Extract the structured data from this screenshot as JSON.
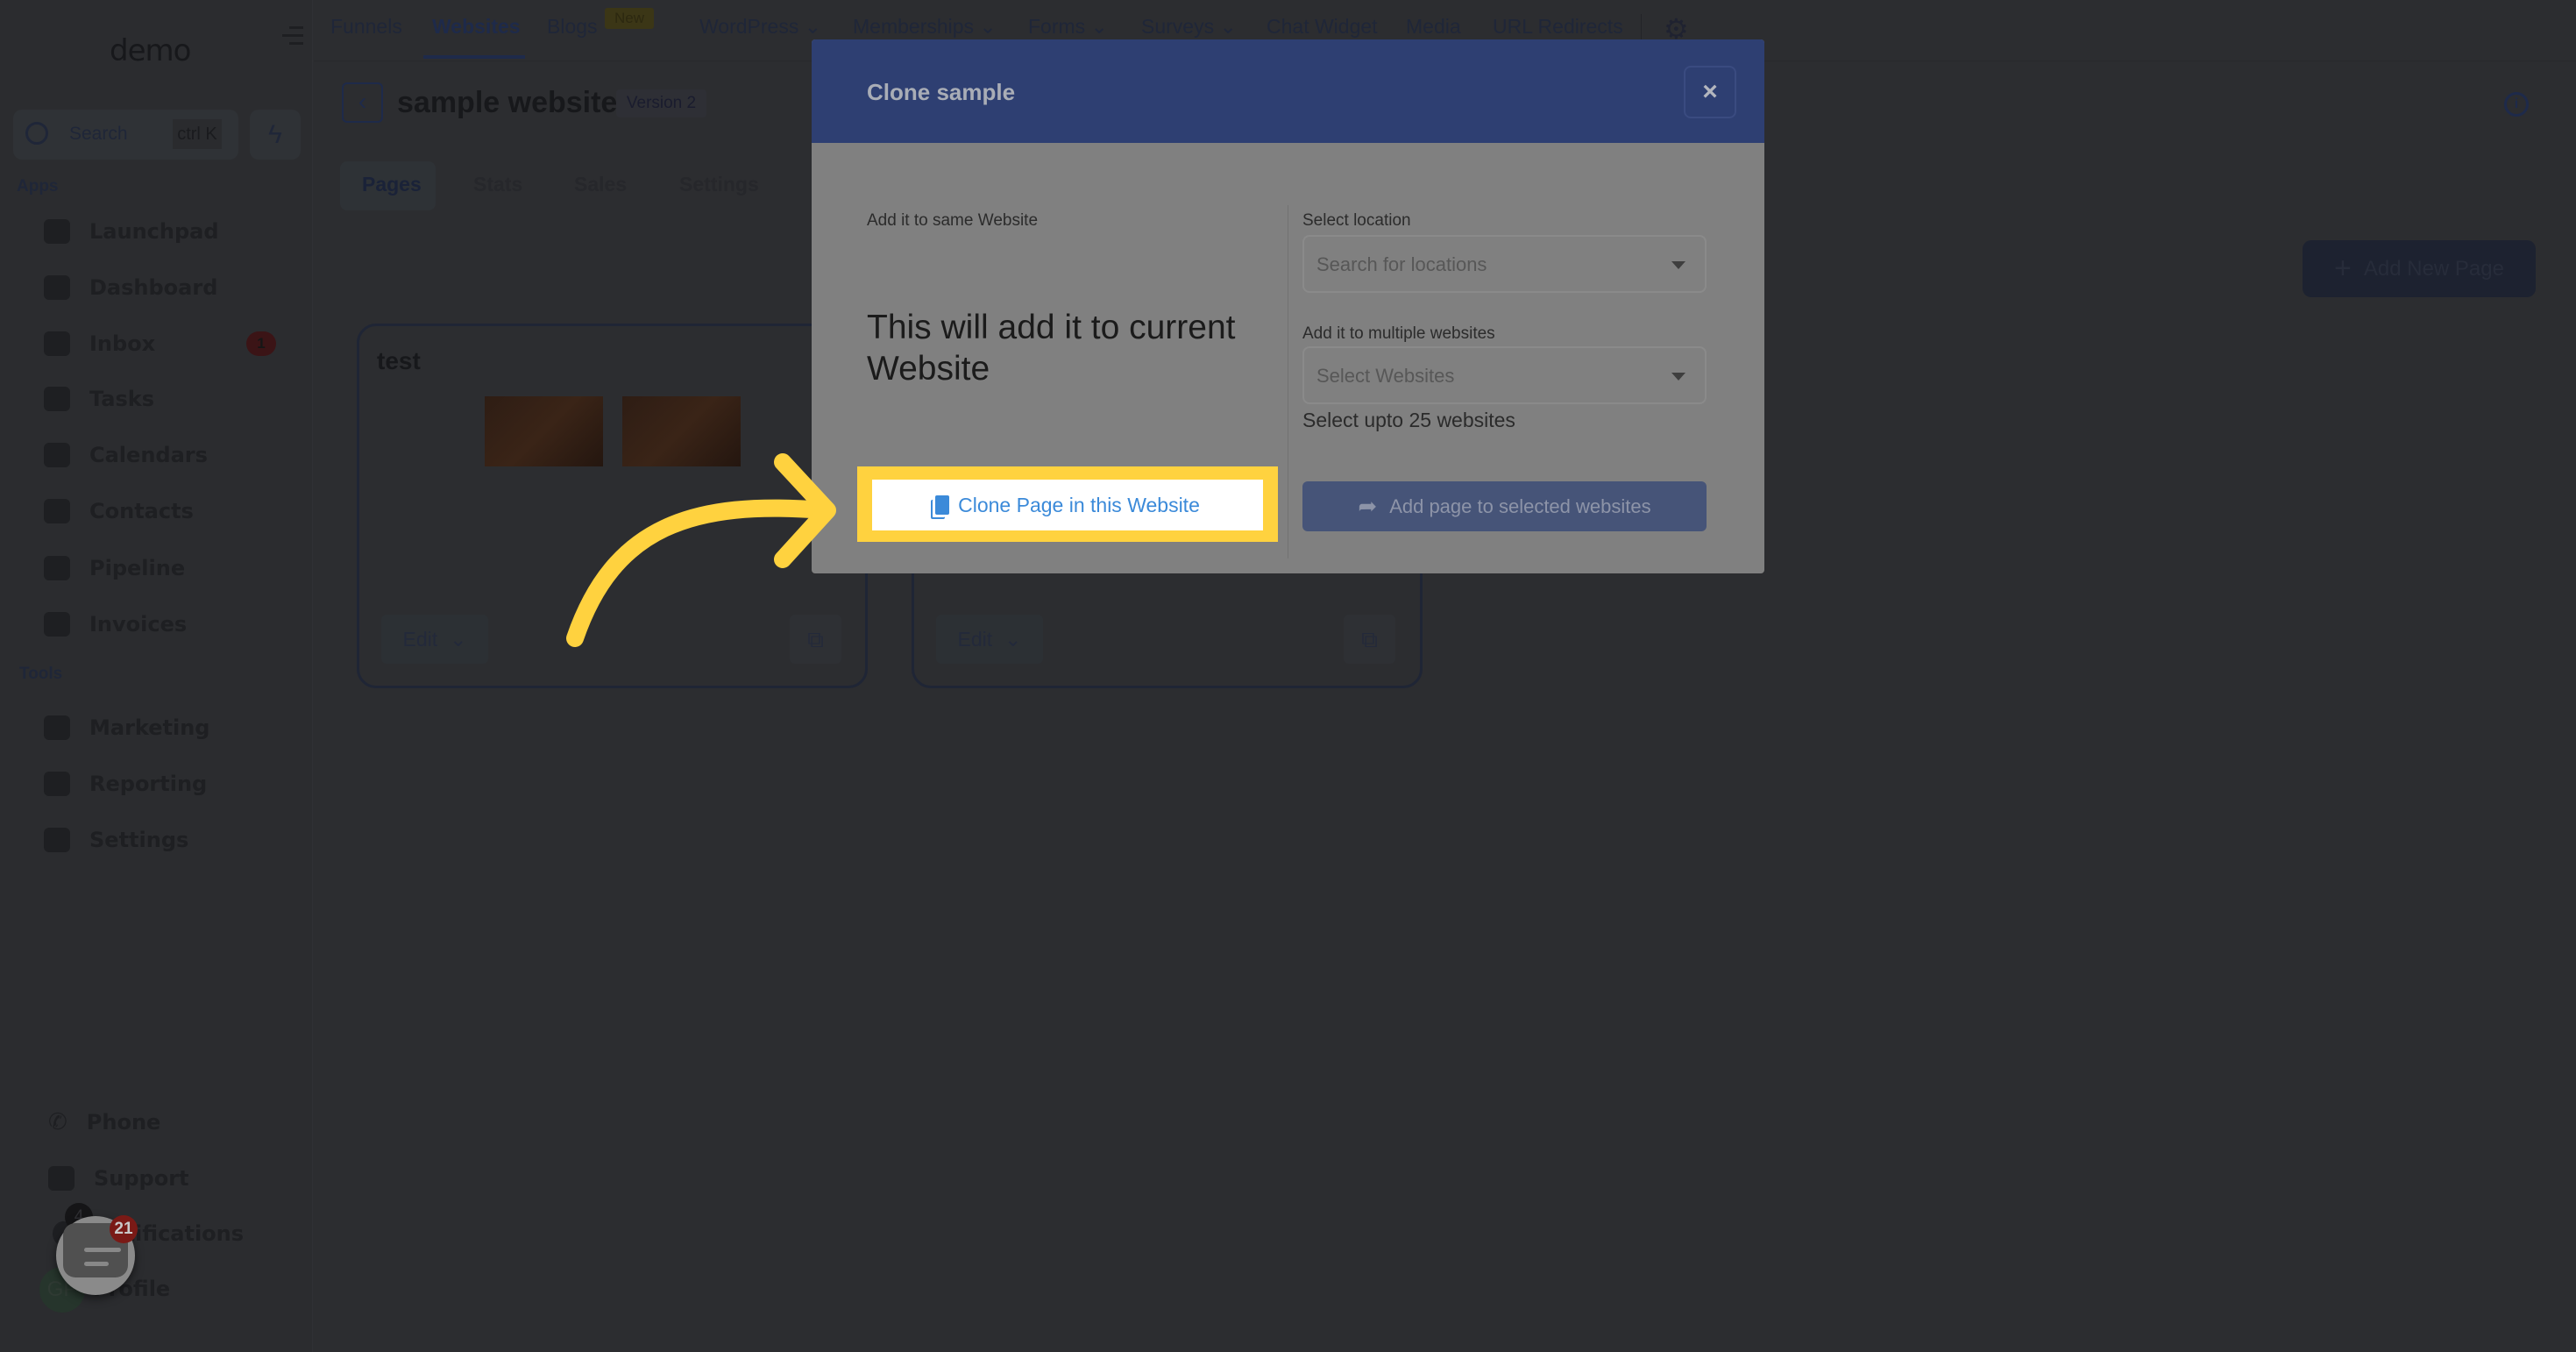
{
  "sidebar": {
    "logo": "demo",
    "search": {
      "label": "Search",
      "shortcut": "ctrl K"
    },
    "apps_label": "Apps",
    "apps": [
      {
        "label": "Launchpad",
        "icon": "rocket-icon"
      },
      {
        "label": "Dashboard",
        "icon": "grid-icon"
      },
      {
        "label": "Inbox",
        "icon": "inbox-icon",
        "badge": "1"
      },
      {
        "label": "Tasks",
        "icon": "clipboard-icon"
      },
      {
        "label": "Calendars",
        "icon": "calendar-icon"
      },
      {
        "label": "Contacts",
        "icon": "user-icon"
      },
      {
        "label": "Pipeline",
        "icon": "funnel-icon"
      },
      {
        "label": "Invoices",
        "icon": "invoice-icon"
      }
    ],
    "tools_label": "Tools",
    "tools": [
      {
        "label": "Marketing",
        "icon": "megaphone-icon"
      },
      {
        "label": "Reporting",
        "icon": "chart-icon"
      },
      {
        "label": "Settings",
        "icon": "gear-icon"
      }
    ],
    "bottom": {
      "phone": "Phone",
      "support": "Support",
      "notifications": "Notifications",
      "notifications_badge": "4",
      "profile": "Profile",
      "avatar_initials": "GP"
    }
  },
  "topnav": {
    "items": [
      "Funnels",
      "Websites",
      "Blogs",
      "WordPress",
      "Memberships",
      "Forms",
      "Surveys",
      "Chat Widget",
      "Media",
      "URL Redirects"
    ],
    "active": "Websites",
    "new_badge": "New"
  },
  "header": {
    "title": "sample website",
    "version": "Version 2"
  },
  "tabs": [
    "Pages",
    "Stats",
    "Sales",
    "Settings"
  ],
  "add_new_page": "Add New Page",
  "cards": [
    {
      "title": "test",
      "edit": "Edit"
    },
    {
      "title": "",
      "edit": "Edit"
    }
  ],
  "modal": {
    "title": "Clone sample",
    "close": "×",
    "left_label": "Add it to same Website",
    "left_text": "This will add it to current Website",
    "clone_button": "Clone Page in this Website",
    "location_label": "Select location",
    "location_placeholder": "Search for locations",
    "websites_label": "Add it to multiple websites",
    "websites_placeholder": "Select Websites",
    "hint": "Select upto 25 websites",
    "add_button": "Add page to selected websites"
  },
  "chat_widget": {
    "badge": "21"
  },
  "colors": {
    "modal_header": "#2e3f72",
    "highlight": "#ffd23f",
    "clone_text": "#3b8ad9",
    "arrow": "#ffd23f"
  }
}
